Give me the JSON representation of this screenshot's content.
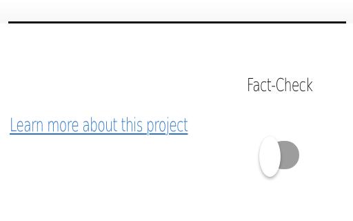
{
  "main": {
    "learn_more_link": "Learn more about this project",
    "fact_check": {
      "label": "Fact-Check",
      "toggle_state": "off",
      "toggle_track_color": "#9d9d9d",
      "toggle_knob_color": "#ffffff"
    }
  },
  "colors": {
    "link": "#2a74c8",
    "label": "#111111",
    "header_rule": "#111111",
    "background": "#ffffff"
  }
}
